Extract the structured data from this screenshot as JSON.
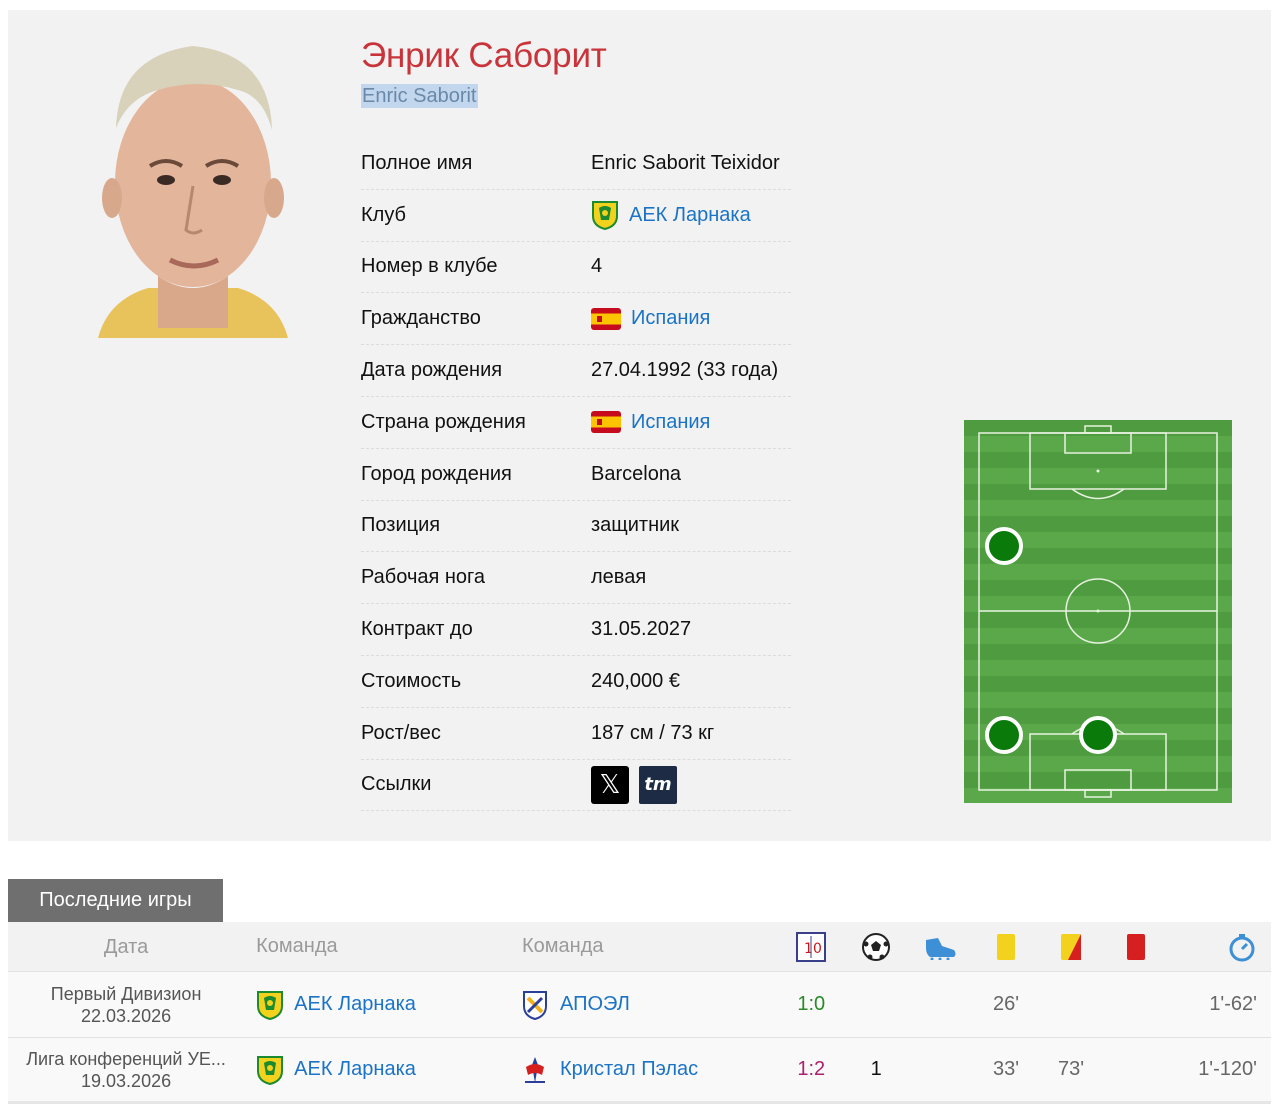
{
  "player": {
    "name_ru": "Энрик Саборит",
    "name_en": "Enric Saborit"
  },
  "info": [
    {
      "label": "Полное имя",
      "value": "Enric Saborit Teixidor"
    },
    {
      "label": "Клуб",
      "value": "АЕК Ларнака",
      "icon": "aek-larnaca-badge"
    },
    {
      "label": "Номер в клубе",
      "value": "4"
    },
    {
      "label": "Гражданство",
      "value": "Испания",
      "icon": "spain-flag"
    },
    {
      "label": "Дата рождения",
      "value": "27.04.1992 (33 года)"
    },
    {
      "label": "Страна рождения",
      "value": "Испания",
      "icon": "spain-flag"
    },
    {
      "label": "Город рождения",
      "value": "Barcelona"
    },
    {
      "label": "Позиция",
      "value": "защитник"
    },
    {
      "label": "Рабочая нога",
      "value": "левая"
    },
    {
      "label": "Контракт до",
      "value": "31.05.2027"
    },
    {
      "label": "Стоимость",
      "value": "240,000 €"
    },
    {
      "label": "Рост/вес",
      "value": "187 см / 73 кг"
    },
    {
      "label": "Ссылки",
      "links": [
        "x-icon",
        "transfermarkt-icon"
      ]
    }
  ],
  "social": {
    "x": "𝕏",
    "tm": "tm"
  },
  "pitch": {
    "colors": {
      "grass_light": "#5aa84a",
      "grass_dark": "#4f9c40",
      "line": "#e8f2e0",
      "marker": "#0a7a0a"
    },
    "positions": [
      "left-back-upper",
      "left-back-lower",
      "centre-back-lower"
    ]
  },
  "recent_games": {
    "tab_label": "Последние игры",
    "headers": {
      "date": "Дата",
      "team1": "Команда",
      "team2": "Команда"
    },
    "header_icons": [
      "score-icon",
      "goal-ball-icon",
      "assist-boot-icon",
      "yellow-card-icon",
      "yellow-red-card-icon",
      "red-card-icon",
      "stopwatch-icon"
    ],
    "rows": [
      {
        "competition": "Первый Дивизион",
        "date": "22.03.2026",
        "team1": "АЕК Ларнака",
        "team2": "АПОЭЛ",
        "score": "1:0",
        "result": "win",
        "goals": "",
        "assists": "",
        "yellow": "26'",
        "yellow_red": "",
        "red": "",
        "minutes": "1'-62'"
      },
      {
        "competition": "Лига конференций УЕ...",
        "date": "19.03.2026",
        "team1": "АЕК Ларнака",
        "team2": "Кристал Пэлас",
        "score": "1:2",
        "result": "loss",
        "goals": "1",
        "assists": "",
        "yellow": "33'",
        "yellow_red": "73'",
        "red": "",
        "minutes": "1'-120'"
      }
    ]
  },
  "colors": {
    "name_red": "#c8343a",
    "link_blue": "#1a73c6",
    "win_green": "#2a8a2a",
    "loss_magenta": "#a8226f"
  }
}
